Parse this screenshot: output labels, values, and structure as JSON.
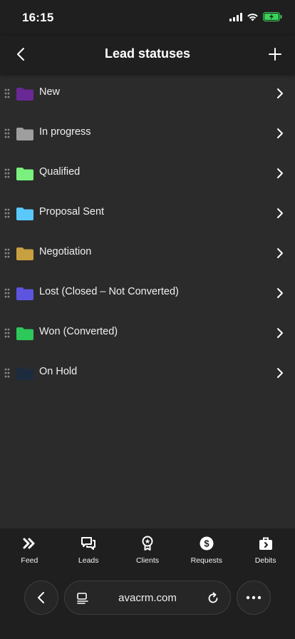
{
  "status_bar": {
    "time": "16:15"
  },
  "header": {
    "title": "Lead statuses"
  },
  "statuses": [
    {
      "label": "New",
      "color": "#6a2894"
    },
    {
      "label": "In progress",
      "color": "#9e9e9e"
    },
    {
      "label": "Qualified",
      "color": "#7bf07f"
    },
    {
      "label": "Proposal Sent",
      "color": "#5ac8fa"
    },
    {
      "label": "Negotiation",
      "color": "#c8a040"
    },
    {
      "label": "Lost (Closed – Not Converted)",
      "color": "#5d55e0"
    },
    {
      "label": "Won (Converted)",
      "color": "#2ec85a"
    },
    {
      "label": "On Hold",
      "color": "#1c2c3e"
    }
  ],
  "tabbar": {
    "tabs": [
      {
        "label": "Feed",
        "icon": "double-chevron-icon"
      },
      {
        "label": "Leads",
        "icon": "chat-bubbles-icon"
      },
      {
        "label": "Clients",
        "icon": "award-badge-icon"
      },
      {
        "label": "Requests",
        "icon": "dollar-circle-icon"
      },
      {
        "label": "Debits",
        "icon": "briefcase-icon"
      }
    ]
  },
  "browser": {
    "address": "avacrm.com"
  },
  "colors": {
    "background": "#1f1f1f",
    "list_background": "#2b2b2b",
    "text": "#ffffff"
  }
}
